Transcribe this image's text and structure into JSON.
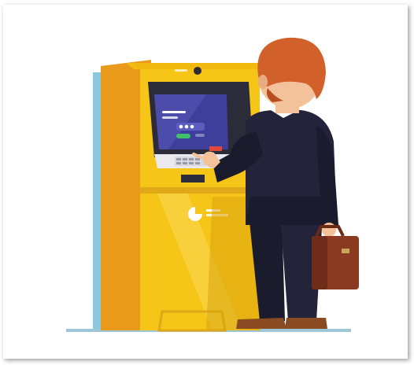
{
  "scene": {
    "subject": "atm-withdrawal",
    "colors": {
      "frame_shadow": "#9a9a9a",
      "ground": "#9fc6d8",
      "atm_body": "#f5c518",
      "atm_side": "#e99a1a",
      "atm_shadow": "#e0a817",
      "screen_bezel": "#2b2b3a",
      "screen": "#3e3f9a",
      "screen_glow": "#6a6cc8",
      "back_panel": "#8cc7e0",
      "hair": "#d2602a",
      "skin": "#f3c29a",
      "suit": "#23233a",
      "shoe": "#8a4a22",
      "briefcase": "#8b3a22"
    },
    "icons": [
      "camera-icon",
      "pie-chart-icon",
      "keypad-icon",
      "card-slot-icon"
    ]
  }
}
